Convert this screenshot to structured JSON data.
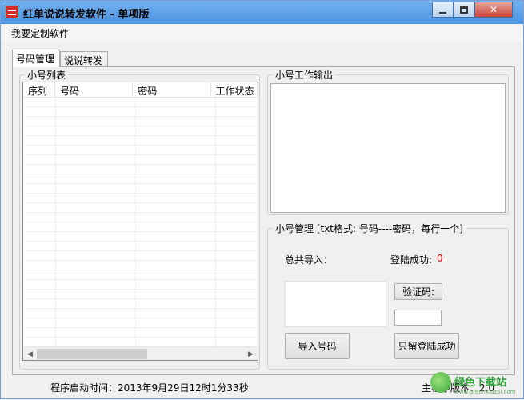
{
  "window": {
    "title": "红单说说转发软件 - 单项版",
    "min_icon": "minimize-icon",
    "max_icon": "maximize-icon",
    "close_label": "✕"
  },
  "menu": {
    "custom": "我要定制软件"
  },
  "tabs": [
    {
      "label": "号码管理",
      "active": true
    },
    {
      "label": "说说转发",
      "active": false
    }
  ],
  "list_group": {
    "title": "小号列表",
    "columns": [
      "序列",
      "号码",
      "密码",
      "工作状态"
    ],
    "scroll_left": "◀",
    "scroll_right": "▶"
  },
  "output_group": {
    "title": "小号工作输出"
  },
  "manager_group": {
    "title": "小号管理 [txt格式: 号码----密码，每行一个]",
    "total_label": "总共导入：",
    "success_label": "登陆成功:",
    "success_value": "0",
    "captcha_label": "验证码:",
    "import_button": "导入号码",
    "keep_success_button": "只留登陆成功"
  },
  "status": {
    "start_time": "程序启动时间：2013年9月29日12时1分33秒",
    "version": "主程序版本：2.0"
  },
  "watermark": {
    "name": "绿色下载站",
    "url": "www.greenxiazai.com"
  },
  "colors": {
    "title_bar": "#5a9ee6",
    "accent_red": "#e00000"
  }
}
